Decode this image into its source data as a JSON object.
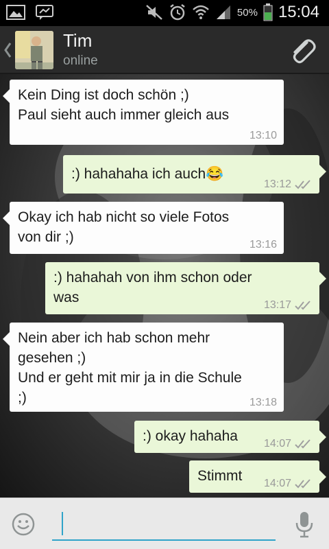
{
  "status_bar": {
    "battery_percent": "50%",
    "time": "15:04",
    "icons": [
      "image-icon",
      "chat-notification-icon",
      "mute-icon",
      "alarm-icon",
      "wifi-icon",
      "signal-icon",
      "battery-icon"
    ],
    "battery_color": "#4caf50"
  },
  "header": {
    "name": "Tim",
    "status": "online",
    "icons": [
      "back-chevron-icon",
      "contact-avatar",
      "attach-paperclip-icon"
    ]
  },
  "messages": [
    {
      "dir": "in",
      "text": "Kein Ding ist doch schön ;)\nPaul sieht auch immer gleich aus",
      "time": "13:10"
    },
    {
      "dir": "out",
      "text": ":) hahahaha ich auch😂",
      "time": "13:12",
      "ticks": "double-check"
    },
    {
      "dir": "in",
      "text": "Okay ich hab nicht so viele Fotos\nvon dir ;)",
      "time": "13:16"
    },
    {
      "dir": "out",
      "text": ":) hahahah von ihm schon oder\nwas",
      "time": "13:17",
      "ticks": "double-check"
    },
    {
      "dir": "in",
      "text": "Nein aber ich hab schon mehr\ngesehen ;)\nUnd er geht mit mir ja in die Schule\n;)",
      "time": "13:18"
    },
    {
      "dir": "out",
      "text": ":) okay hahaha",
      "time": "14:07",
      "ticks": "double-check"
    },
    {
      "dir": "out",
      "text": "Stimmt",
      "time": "14:07",
      "ticks": "double-check"
    }
  ],
  "input": {
    "value": "",
    "placeholder": "",
    "icons": [
      "emoji-icon",
      "mic-icon"
    ]
  },
  "colors": {
    "incoming_bubble": "#fdfdfd",
    "outgoing_bubble": "#eaf7d8",
    "accent": "#2fa3c9",
    "header_bg": "#2a2a2a"
  }
}
